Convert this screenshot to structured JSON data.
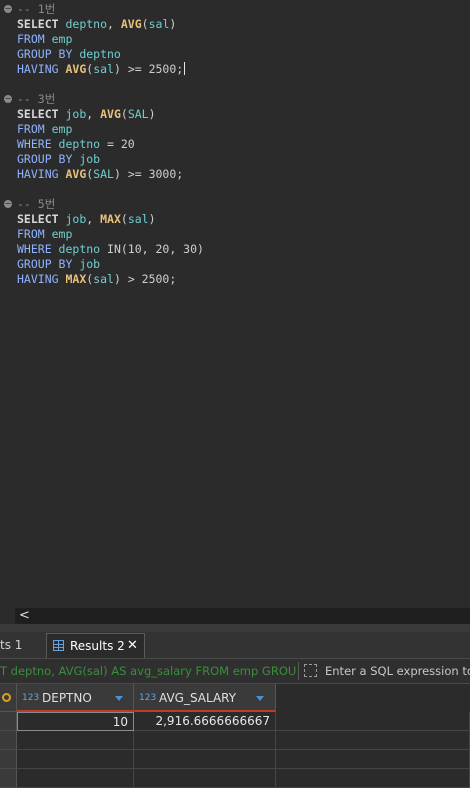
{
  "editor": {
    "blocks": [
      {
        "comment": "-- 1번",
        "lines": [
          [
            {
              "t": "SELECT ",
              "c": "kw"
            },
            {
              "t": "deptno",
              "c": "id"
            },
            {
              "t": ", ",
              "c": ""
            },
            {
              "t": "AVG",
              "c": "fn"
            },
            {
              "t": "(",
              "c": ""
            },
            {
              "t": "sal",
              "c": "id"
            },
            {
              "t": ")",
              "c": ""
            }
          ],
          [
            {
              "t": "FROM ",
              "c": "kw-blue"
            },
            {
              "t": "emp",
              "c": "id"
            }
          ],
          [
            {
              "t": "GROUP BY ",
              "c": "kw-blue"
            },
            {
              "t": "deptno",
              "c": "id"
            }
          ],
          [
            {
              "t": "HAVING ",
              "c": "kw-blue"
            },
            {
              "t": "AVG",
              "c": "fn"
            },
            {
              "t": "(",
              "c": ""
            },
            {
              "t": "sal",
              "c": "id"
            },
            {
              "t": ") >= 2500;",
              "c": ""
            }
          ]
        ]
      },
      {
        "comment": "-- 3번",
        "lines": [
          [
            {
              "t": "SELECT ",
              "c": "kw"
            },
            {
              "t": "job",
              "c": "id"
            },
            {
              "t": ", ",
              "c": ""
            },
            {
              "t": "AVG",
              "c": "fn"
            },
            {
              "t": "(",
              "c": ""
            },
            {
              "t": "SAL",
              "c": "id"
            },
            {
              "t": ")",
              "c": ""
            }
          ],
          [
            {
              "t": "FROM ",
              "c": "kw-blue"
            },
            {
              "t": "emp",
              "c": "id"
            }
          ],
          [
            {
              "t": "WHERE ",
              "c": "kw-blue"
            },
            {
              "t": "deptno",
              "c": "id"
            },
            {
              "t": " = 20",
              "c": ""
            }
          ],
          [
            {
              "t": "GROUP BY ",
              "c": "kw-blue"
            },
            {
              "t": "job",
              "c": "id"
            }
          ],
          [
            {
              "t": "HAVING ",
              "c": "kw-blue"
            },
            {
              "t": "AVG",
              "c": "fn"
            },
            {
              "t": "(",
              "c": ""
            },
            {
              "t": "SAL",
              "c": "id"
            },
            {
              "t": ") >= 3000;",
              "c": ""
            }
          ]
        ]
      },
      {
        "comment": "-- 5번",
        "lines": [
          [
            {
              "t": "SELECT ",
              "c": "kw"
            },
            {
              "t": "job",
              "c": "id"
            },
            {
              "t": ", ",
              "c": ""
            },
            {
              "t": "MAX",
              "c": "fn"
            },
            {
              "t": "(",
              "c": ""
            },
            {
              "t": "sal",
              "c": "id"
            },
            {
              "t": ")",
              "c": ""
            }
          ],
          [
            {
              "t": "FROM ",
              "c": "kw-blue"
            },
            {
              "t": "emp",
              "c": "id"
            }
          ],
          [
            {
              "t": "WHERE ",
              "c": "kw-blue"
            },
            {
              "t": "deptno",
              "c": "id"
            },
            {
              "t": " IN(10, 20, 30)",
              "c": ""
            }
          ],
          [
            {
              "t": "GROUP BY ",
              "c": "kw-blue"
            },
            {
              "t": "job",
              "c": "id"
            }
          ],
          [
            {
              "t": "HAVING ",
              "c": "kw-blue"
            },
            {
              "t": "MAX",
              "c": "fn"
            },
            {
              "t": "(",
              "c": ""
            },
            {
              "t": "sal",
              "c": "id"
            },
            {
              "t": ") > 2500;",
              "c": ""
            }
          ]
        ]
      }
    ]
  },
  "scrollbar": {
    "left_arrow": "<"
  },
  "tabs": {
    "tab1_label": "ts 1",
    "tab2_label": "Results 2",
    "close_glyph": "✕"
  },
  "filter": {
    "query_text": "T deptno, AVG(sal) AS avg_salary FROM emp GROUP B",
    "placeholder": "Enter a SQL expression to fil"
  },
  "grid": {
    "columns": [
      {
        "type": "123",
        "name": "DEPTNO"
      },
      {
        "type": "123",
        "name": "AVG_SALARY"
      }
    ],
    "rows": [
      [
        "10",
        "2,916.6666666667"
      ]
    ]
  }
}
